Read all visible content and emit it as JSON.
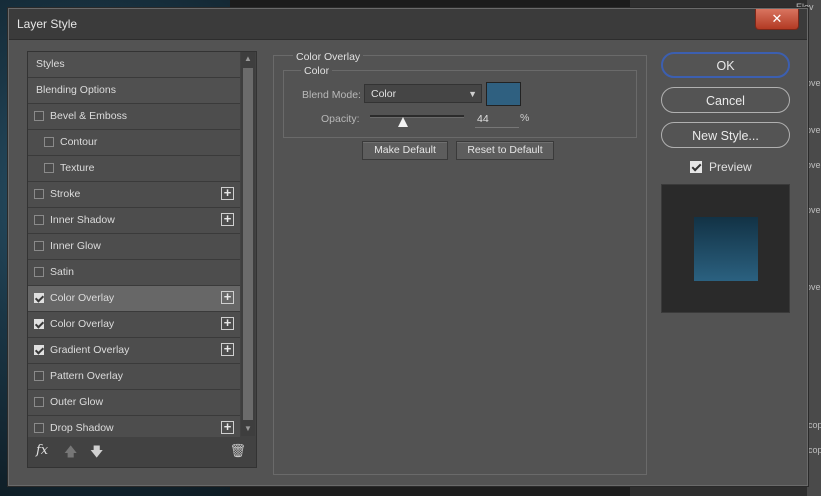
{
  "window": {
    "title": "Layer Style",
    "close": "✕"
  },
  "background": {
    "items": [
      "over",
      "over",
      "over",
      "over",
      "over",
      "cop",
      "cop"
    ],
    "top_label": "Elev"
  },
  "styles_panel": {
    "items": [
      {
        "label": "Styles",
        "type": "header"
      },
      {
        "label": "Blending Options",
        "type": "header"
      },
      {
        "label": "Bevel & Emboss",
        "checked": false,
        "plus": false
      },
      {
        "label": "Contour",
        "checked": false,
        "sub": true
      },
      {
        "label": "Texture",
        "checked": false,
        "sub": true
      },
      {
        "label": "Stroke",
        "checked": false,
        "plus": true
      },
      {
        "label": "Inner Shadow",
        "checked": false,
        "plus": true
      },
      {
        "label": "Inner Glow",
        "checked": false,
        "plus": false
      },
      {
        "label": "Satin",
        "checked": false,
        "plus": false
      },
      {
        "label": "Color Overlay",
        "checked": true,
        "plus": true,
        "selected": true
      },
      {
        "label": "Color Overlay",
        "checked": true,
        "plus": true
      },
      {
        "label": "Gradient Overlay",
        "checked": true,
        "plus": true
      },
      {
        "label": "Pattern Overlay",
        "checked": false,
        "plus": false
      },
      {
        "label": "Outer Glow",
        "checked": false,
        "plus": false
      },
      {
        "label": "Drop Shadow",
        "checked": false,
        "plus": true
      }
    ],
    "footer": {
      "fx": "fx",
      "up": "🡅",
      "down": "🡇",
      "trash": "🗑"
    }
  },
  "color_overlay": {
    "group_title": "Color Overlay",
    "sub_title": "Color",
    "blend_mode_label": "Blend Mode:",
    "blend_mode_value": "Color",
    "swatch_color": "#2f6080",
    "opacity_label": "Opacity:",
    "opacity_value": "44",
    "opacity_unit": "%",
    "opacity_level": 0.44,
    "make_default": "Make Default",
    "reset_default": "Reset to Default"
  },
  "actions": {
    "ok": "OK",
    "cancel": "Cancel",
    "new_style": "New Style...",
    "preview_label": "Preview",
    "preview_checked": true
  },
  "colors": {
    "accent": "#3c5fb0",
    "overlay": "#2f6080"
  }
}
